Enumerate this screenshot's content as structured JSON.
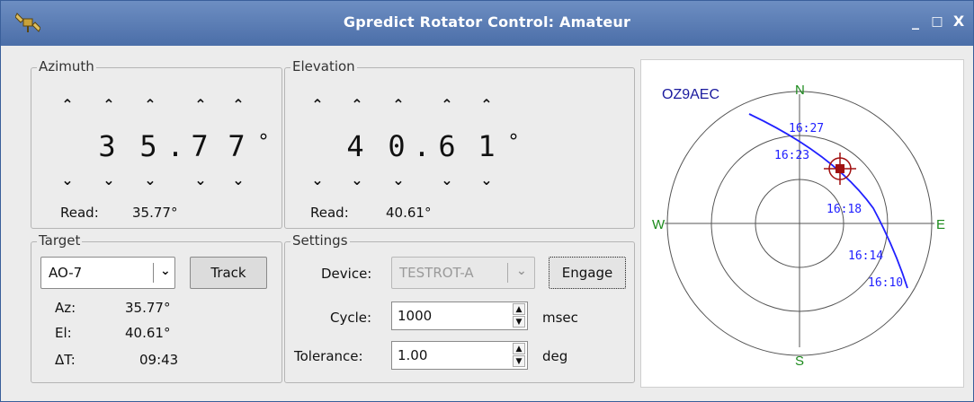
{
  "window": {
    "title": "Gpredict Rotator Control: Amateur",
    "icon": "satellite-icon",
    "controls": {
      "minimize": "_",
      "maximize": "□",
      "close": "X"
    }
  },
  "azimuth": {
    "label": "Azimuth",
    "digits": [
      "3",
      "5",
      ".",
      "7",
      "7"
    ],
    "degree": "°",
    "read_label": "Read:",
    "read_value": "35.77°"
  },
  "elevation": {
    "label": "Elevation",
    "digits": [
      "4",
      "0",
      ".",
      "6",
      "1"
    ],
    "degree": "°",
    "read_label": "Read:",
    "read_value": "40.61°"
  },
  "target": {
    "label": "Target",
    "satellite": "AO-7",
    "track_button": "Track",
    "az_label": "Az:",
    "az_value": "35.77°",
    "el_label": "El:",
    "el_value": "40.61°",
    "dt_label": "ΔT:",
    "dt_value": "09:43"
  },
  "settings": {
    "label": "Settings",
    "device_label": "Device:",
    "device_value": "TESTROT-A",
    "engage_button": "Engage",
    "cycle_label": "Cycle:",
    "cycle_value": "1000",
    "cycle_unit": "msec",
    "tolerance_label": "Tolerance:",
    "tolerance_value": "1.00",
    "tolerance_unit": "deg"
  },
  "polar": {
    "station": "OZ9AEC",
    "north": "N",
    "south": "S",
    "east": "E",
    "west": "W",
    "times": [
      "16:27",
      "16:23",
      "16:18",
      "16:14",
      "16:10"
    ],
    "colors": {
      "track": "#2020ff",
      "station": "#1a1a9e",
      "compass": "#1c8a1c",
      "target": "#a01010"
    }
  }
}
